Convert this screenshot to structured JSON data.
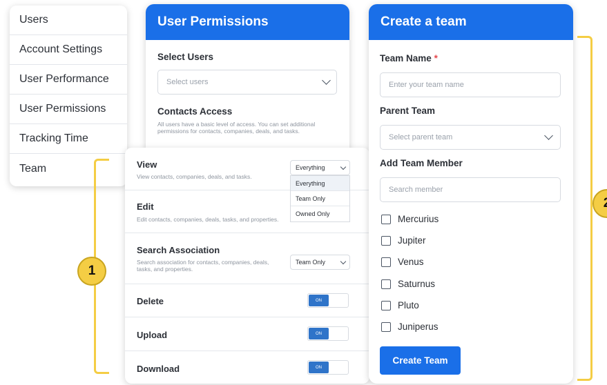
{
  "sidebar": {
    "items": [
      {
        "label": "Users"
      },
      {
        "label": "Account Settings"
      },
      {
        "label": "User Performance"
      },
      {
        "label": "User Permissions"
      },
      {
        "label": "Tracking Time"
      },
      {
        "label": "Team"
      }
    ]
  },
  "permissions": {
    "title": "User Permissions",
    "select_users_label": "Select Users",
    "select_users_placeholder": "Select users",
    "contacts_label": "Contacts Access",
    "contacts_desc": "All users have a basic level of access. You can set additional permissions for contacts, companies, deals, and tasks.",
    "rows": {
      "view": {
        "title": "View",
        "desc": "View contacts, companies, deals, and tasks.",
        "value": "Everything"
      },
      "edit": {
        "title": "Edit",
        "desc": "Edit contacts, companies, deals, tasks, and properties."
      },
      "search": {
        "title": "Search Association",
        "desc": "Search association for contacts, companies, deals, tasks, and properties.",
        "value": "Team Only"
      },
      "delete": {
        "title": "Delete",
        "toggle": "ON"
      },
      "upload": {
        "title": "Upload",
        "toggle": "ON"
      },
      "download": {
        "title": "Download",
        "toggle": "ON"
      }
    },
    "dropdown_options": [
      "Everything",
      "Team Only",
      "Owned Only"
    ]
  },
  "team": {
    "title": "Create a team",
    "team_name_label": "Team Name",
    "required_mark": "*",
    "team_name_placeholder": "Enter your team name",
    "parent_team_label": "Parent Team",
    "parent_team_placeholder": "Select parent team",
    "add_member_label": "Add Team Member",
    "search_member_placeholder": "Search member",
    "members": [
      "Mercurius",
      "Jupiter",
      "Venus",
      "Saturnus",
      "Pluto",
      "Juniperus"
    ],
    "create_button": "Create Team"
  },
  "annotations": {
    "badge_1": "1",
    "badge_2": "2"
  },
  "colors": {
    "primary": "#1a6fe8",
    "toggle_on": "#2f74c9",
    "annotation": "#f4cd44"
  }
}
